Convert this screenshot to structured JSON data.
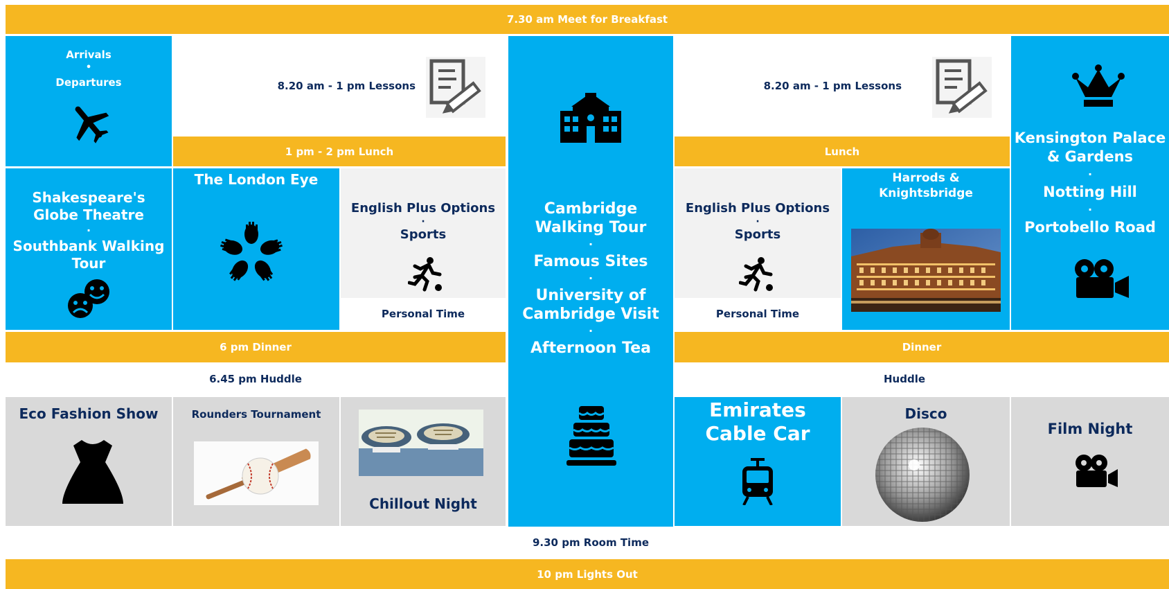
{
  "colors": {
    "blue": "#00aeef",
    "orange": "#f6b721",
    "navy": "#0d2a5c",
    "light_grey": "#f2f2f2",
    "grey": "#d9d9d9"
  },
  "bars": {
    "breakfast": "7.30 am   Meet for Breakfast",
    "lunch_1": "1 pm - 2 pm  Lunch",
    "lunch_2": "Lunch",
    "dinner_1": "6 pm Dinner",
    "dinner_2": "Dinner",
    "huddle_1": "6.45 pm  Huddle",
    "huddle_2": "Huddle",
    "room_time": "9.30 pm  Room Time",
    "lights_out": "10 pm  Lights Out"
  },
  "arrivals": {
    "line1": "Arrivals",
    "dot": "•",
    "line2": "Departures",
    "icon": "airplane-icon"
  },
  "lessons": {
    "label": "8.20 am - 1 pm  Lessons",
    "icon": "document-pencil-icon"
  },
  "globe": {
    "line1": "Shakespeare's",
    "line2": "Globe Theatre",
    "dot": "·",
    "line3": "Southbank Walking",
    "line4": "Tour",
    "icon": "theatre-masks-icon"
  },
  "london_eye": {
    "title": "The London Eye",
    "icon": "hands-circle-icon"
  },
  "options": {
    "title": "English Plus Options",
    "dot": "·",
    "sports": "Sports",
    "personal": "Personal Time",
    "icon": "football-player-icon"
  },
  "cambridge": {
    "line1": "Cambridge",
    "line2": "Walking Tour",
    "dot": "·",
    "line3": "Famous Sites",
    "line4": "University of",
    "line5": "Cambridge Visit",
    "line6": "Afternoon Tea",
    "icons": [
      "school-building-icon",
      "layer-cake-icon"
    ]
  },
  "harrods": {
    "line1": "Harrods &",
    "line2": "Knightsbridge",
    "image": "harrods-building-photo"
  },
  "kensington": {
    "line1": "Kensington Palace",
    "line2": "& Gardens",
    "dot": "·",
    "line3": "Notting Hill",
    "line4": "Portobello Road",
    "icons": [
      "crown-icon",
      "movie-camera-icon"
    ]
  },
  "evening": {
    "eco": {
      "title": "Eco Fashion Show",
      "icon": "dress-icon"
    },
    "rounders": {
      "title": "Rounders Tournament",
      "image": "bat-and-ball-photo"
    },
    "chillout": {
      "title": "Chillout Night",
      "image": "sneakers-photo"
    },
    "emirates": {
      "line1": "Emirates",
      "line2": "Cable Car",
      "icon": "tram-icon"
    },
    "disco": {
      "title": "Disco",
      "image": "disco-ball-photo"
    },
    "film": {
      "title": "Film Night",
      "icon": "movie-camera-icon"
    }
  }
}
